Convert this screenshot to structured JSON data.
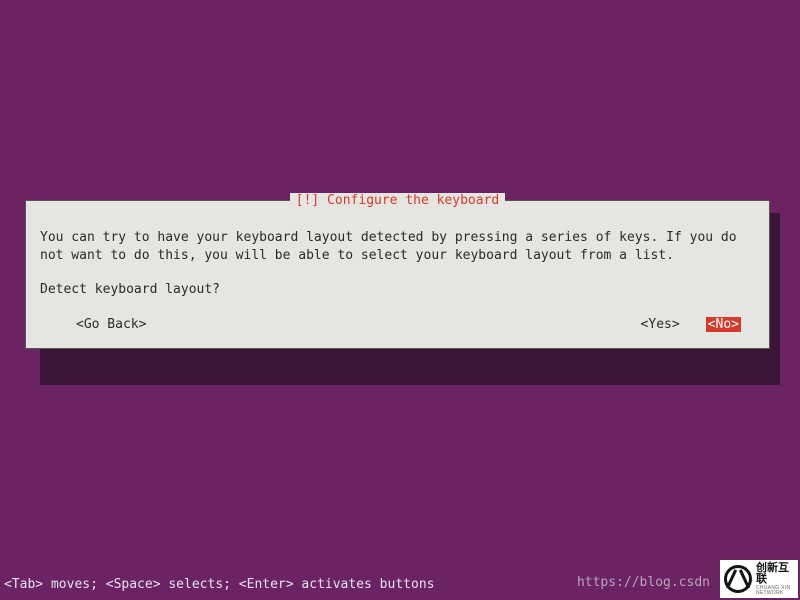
{
  "dialog": {
    "title": "[!] Configure the keyboard",
    "body": "You can try to have your keyboard layout detected by pressing a series of keys. If you do\nnot want to do this, you will be able to select your keyboard layout from a list.",
    "question": "Detect keyboard layout?",
    "go_back": "<Go Back>",
    "yes": "<Yes>",
    "no": "<No>"
  },
  "help_bar": "<Tab> moves; <Space> selects; <Enter> activates buttons",
  "watermark": {
    "url": "https://blog.csdn",
    "logo_main": "创新互联",
    "logo_sub": "CHUANG XIN NETWORK"
  }
}
